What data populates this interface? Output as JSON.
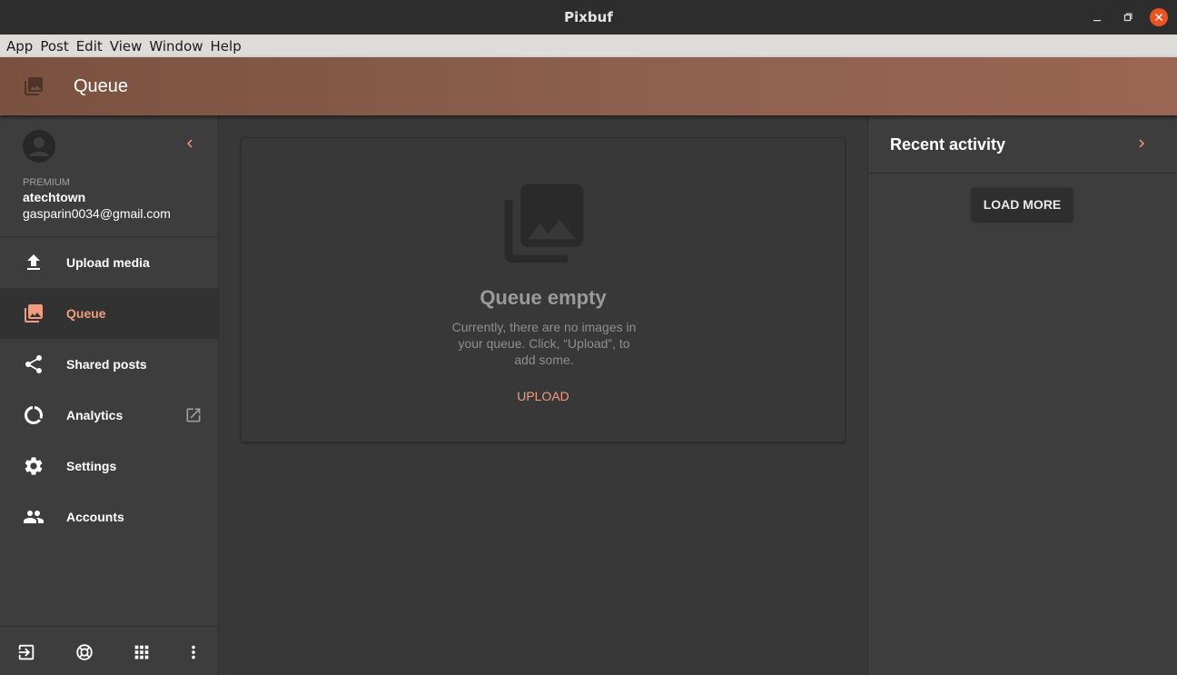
{
  "window": {
    "title": "Pixbuf"
  },
  "menubar": {
    "items": [
      "App",
      "Post",
      "Edit",
      "View",
      "Window",
      "Help"
    ]
  },
  "appbar": {
    "title": "Queue",
    "icon": "photo-library-icon"
  },
  "profile": {
    "tier": "PREMIUM",
    "username": "atechtown",
    "email": "gasparin0034@gmail.com"
  },
  "sidebar": {
    "items": [
      {
        "label": "Upload media",
        "icon": "upload-icon",
        "active": false
      },
      {
        "label": "Queue",
        "icon": "photo-library-icon",
        "active": true
      },
      {
        "label": "Shared posts",
        "icon": "share-icon",
        "active": false
      },
      {
        "label": "Analytics",
        "icon": "analytics-icon",
        "active": false,
        "external": true
      },
      {
        "label": "Settings",
        "icon": "gear-icon",
        "active": false
      },
      {
        "label": "Accounts",
        "icon": "people-icon",
        "active": false
      }
    ],
    "footer": [
      "logout-icon",
      "help-icon",
      "apps-grid-icon",
      "more-vert-icon"
    ]
  },
  "main": {
    "empty_title": "Queue empty",
    "empty_desc": "Currently, there are no images in your queue. Click, “Upload”, to add some.",
    "upload_label": "UPLOAD"
  },
  "right_panel": {
    "title": "Recent activity",
    "load_more_label": "LOAD MORE"
  },
  "colors": {
    "accent": "#f19c7e",
    "header_gradient_start": "#7a5140",
    "header_gradient_end": "#9b6553",
    "close_button": "#e95420"
  }
}
